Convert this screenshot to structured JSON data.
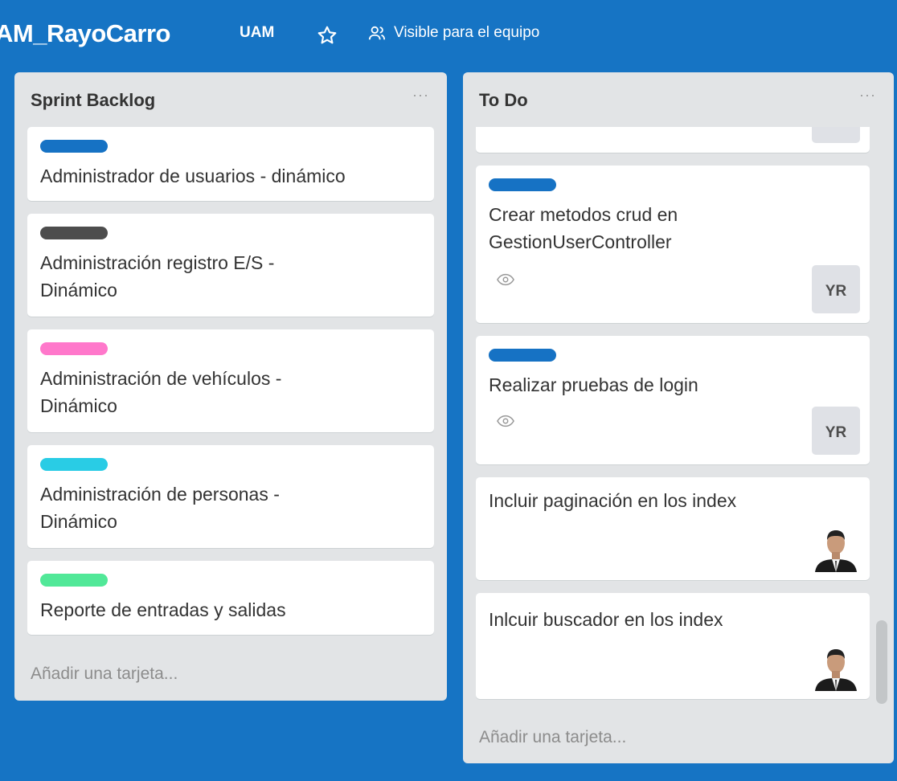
{
  "header": {
    "board_title": "AM_RayoCarro",
    "team": "UAM",
    "visibility": "Visible para el equipo",
    "icons": [
      "star-icon",
      "team-icon"
    ]
  },
  "lists": [
    {
      "title": "Sprint Backlog",
      "menu": "···",
      "add_card": "Añadir una tarjeta...",
      "cards": [
        {
          "label_color": "#1672c4",
          "title_lines": [
            "Administrador de usuarios - dinámico"
          ]
        },
        {
          "label_color": "#4d4d4d",
          "title_lines": [
            "Administración registro E/S -",
            "Dinámico"
          ]
        },
        {
          "label_color": "#ff78cb",
          "title_lines": [
            "Administración de vehículos -",
            "Dinámico"
          ]
        },
        {
          "label_color": "#29cce5",
          "title_lines": [
            "Administración de personas -",
            "Dinámico"
          ]
        },
        {
          "label_color": "#51e898",
          "title_lines": [
            "Reporte de entradas y salidas"
          ]
        }
      ]
    },
    {
      "title": "To Do",
      "menu": "···",
      "add_card": "Añadir una tarjeta...",
      "cards": [
        {
          "label_color": "#1672c4",
          "title_lines": [
            "Crear metodos crud en",
            "GestionUserController"
          ],
          "member": "YR"
        },
        {
          "label_color": "#1672c4",
          "title_lines": [
            "Realizar pruebas de login"
          ],
          "member": "YR"
        },
        {
          "title_lines": [
            "Incluir paginación en los index"
          ],
          "member_avatar": "avatar-photo"
        },
        {
          "title_lines": [
            "Inlcuir buscador en los index"
          ],
          "member_avatar": "avatar-photo"
        }
      ]
    }
  ]
}
